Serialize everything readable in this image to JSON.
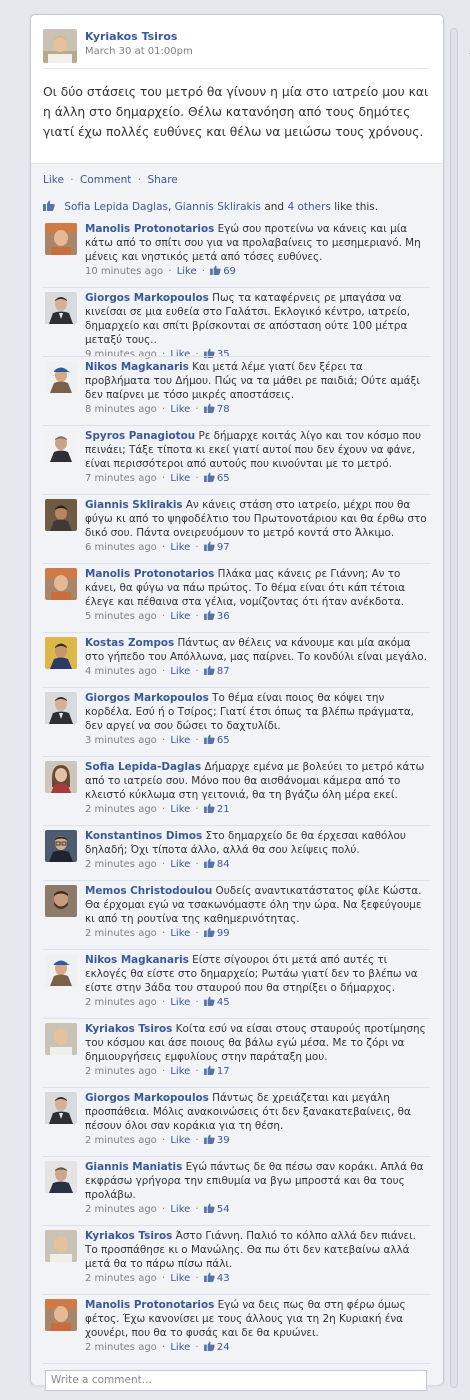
{
  "post": {
    "author": "Kyriakos Tsiros",
    "time": "March 30 at 01:00pm",
    "text": "Οι δύο στάσεις του μετρό θα γίνουν η μία στο ιατρείο μου και η άλλη στο δημαρχείο. Θέλω κατανόηση από τους δημότες γιατί έχω πολλές ευθύνες και θέλω να μειώσω τους χρόνους."
  },
  "actions": {
    "like": "Like",
    "comment": "Comment",
    "share": "Share",
    "sep": "·"
  },
  "likes": {
    "name1": "Sofia Lepida Daglas",
    "comma": ",",
    "name2": "Giannis Sklirakis",
    "and": "and",
    "others": "4 others",
    "suffix": "like this."
  },
  "comments": [
    {
      "name": "Manolis Protonotarios",
      "text": "Εγώ σου προτείνω να κάνεις και μία κάτω από το σπίτι σου για να προλαβαίνεις το μεσημεριανό. Μη μένεις και νηστικός μετά από τόσες ευθύνες.",
      "time": "10 minutes ago",
      "like": "Like",
      "count": "69",
      "avatar": "orange-hat-man"
    },
    {
      "name": "Giorgos Markopoulos",
      "text": "Πως τα καταφέρνεις ρε μπαγάσα να κινείσαι σε μια ευθεία στο Γαλάτσι. Εκλογικό κέντρο, ιατρείο, δημαρχείο και σπίτι βρίσκονται σε απόσταση ούτε 100 μέτρα μεταξύ τους..",
      "time": "9 minutes ago",
      "like": "Like",
      "count": "35",
      "avatar": "man-in-suit"
    },
    {
      "name": "Nikos Magkanaris",
      "text": "Και μετά λέμε γιατί δεν ξέρει τα προβλήματα του Δήμου. Πώς να τα μάθει ρε παιδιά; Ούτε αμάξι δεν παίρνει με τόσο μικρές αποστάσεις.",
      "time": "8 minutes ago",
      "like": "Like",
      "count": "78",
      "avatar": "man-in-cap"
    },
    {
      "name": "Spyros Panagiotou",
      "text": "Ρε δήμαρχε κοιτάς λίγο και τον κόσμο που πεινάει; Τάξε τίποτα κι εκεί γιατί αυτοί που δεν έχουν να φάνε, είναι περισσότεροι από αυτούς που κινούνται με το μετρό.",
      "time": "7 minutes ago",
      "like": "Like",
      "count": "65",
      "avatar": "man-white-bg"
    },
    {
      "name": "Giannis Sklirakis",
      "text": "Αν κάνεις στάση στο ιατρείο, μέχρι που θα φύγω κι από το ψηφοδέλτιο του Πρωτονοτάριου και θα έρθω στο δικό σου. Πάντα ονειρευόμουν το μετρό κοντά στο Άλκιμο.",
      "time": "6 minutes ago",
      "like": "Like",
      "count": "97",
      "avatar": "man-dark"
    },
    {
      "name": "Manolis Protonotarios",
      "text": "Πλάκα μας κάνεις ρε Γιάννη; Αν το κάνει, θα φύγω να πάω πρώτος. Το θέμα είναι ότι κάπ τέτοια έλεγε και πέθαινα στα γέλια, νομίζοντας ότι ήταν ανέκδοτα.",
      "time": "5 minutes ago",
      "like": "Like",
      "count": "36",
      "avatar": "orange-hat-man"
    },
    {
      "name": "Kostas Zompos",
      "text": "Πάντως αν θέλεις να κάνουμε και μία ακόμα στο γήπεδο του Απόλλωνα, μας παίρνει. Το κονδύλι είναι μεγάλο.",
      "time": "4 minutes ago",
      "like": "Like",
      "count": "87",
      "avatar": "man-yellow"
    },
    {
      "name": "Giorgos Markopoulos",
      "text": "Το θέμα είναι ποιος θα κόψει την κορδέλα. Εσύ ή ο Τσίρος; Γιατί έτσι όπως τα βλέπω πράγματα, δεν αργεί να σου δώσει το δαχτυλίδι.",
      "time": "3 minutes ago",
      "like": "Like",
      "count": "65",
      "avatar": "man-in-suit"
    },
    {
      "name": "Sofia Lepida-Daglas",
      "text": "Δήμαρχε εμένα με βολεύει το μετρό κάτω από το ιατρείο σου. Μόνο που θα αισθάνομαι κάμερα από το κλειστό κύκλωμα στη γειτονιά, θα τη βγάζω όλη μέρα εκεί.",
      "time": "2 minutes ago",
      "like": "Like",
      "count": "21",
      "avatar": "woman"
    },
    {
      "name": "Konstantinos Dimos",
      "text": "Στο δημαρχείο δε θα έρχεσαι καθόλου δηλαδή; Όχι τίποτα άλλο, αλλά θα σου λείψεις πολύ.",
      "time": "2 minutes ago",
      "like": "Like",
      "count": "84",
      "avatar": "man-glasses"
    },
    {
      "name": "Memos Christodoulou",
      "text": "Ουδείς αναντικατάστατος φίλε Κώστα. Θα έρχομαι εγώ να τσακωνόμαστε όλη την ώρα. Να ξεφεύγουμε κι από τη ρουτίνα της καθημερινότητας.",
      "time": "2 minutes ago",
      "like": "Like",
      "count": "99",
      "avatar": "man-beard"
    },
    {
      "name": "Nikos Magkanaris",
      "text": "Είστε σίγουροι ότι μετά από αυτές τι εκλογές θα είστε στο δημαρχείο; Ρωτάω γιατί δεν το βλέπω να είστε στην 3άδα του σταυρού που θα στηρίξει ο δήμαρχος.",
      "time": "2 minutes ago",
      "like": "Like",
      "count": "45",
      "avatar": "man-in-cap"
    },
    {
      "name": "Kyriakos Tsiros",
      "text": "Κοίτα εσύ να είσαι στους σταυρούς προτίμησης του κόσμου και άσε ποιους θα βάλω εγώ μέσα. Με το ζόρι να δημιουργήσεις εμφυλίους στην παράταξη μου.",
      "time": "2 minutes ago",
      "like": "Like",
      "count": "17",
      "avatar": "bald-man"
    },
    {
      "name": "Giorgos Markopoulos",
      "text": "Πάντως δε χρειάζεται και μεγάλη προσπάθεια. Μόλις ανακοινώσεις ότι δεν ξανακατεβαίνεις, θα πέσουν όλοι σαν κοράκια για τη θέση.",
      "time": "2 minutes ago",
      "like": "Like",
      "count": "39",
      "avatar": "man-in-suit"
    },
    {
      "name": "Giannis Maniatis",
      "text": "Εγώ πάντως δε θα πέσω σαν κοράκι. Απλά θα εκφράσω γρήγορα την επιθυμία να βγω μπροστά και θα τους προλάβω.",
      "time": "2 minutes ago",
      "like": "Like",
      "count": "54",
      "avatar": "man-grey"
    },
    {
      "name": "Kyriakos Tsiros",
      "text": "Άστο Γιάννη. Παλιό το κόλπο αλλά δεν πιάνει. Το προσπάθησε κι ο Μανώλης. Θα πω ότι δεν κατεβαίνω αλλά μετά θα το πάρω πίσω πάλι.",
      "time": "2 minutes ago",
      "like": "Like",
      "count": "43",
      "avatar": "bald-man"
    },
    {
      "name": "Manolis Protonotarios",
      "text": "Εγώ να δεις πως θα στη φέρω όμως φέτος. Έχω κανονίσει με τους άλλους για τη 2η Κυριακή ένα χουνέρι, που θα το φυσάς και δε θα κρυώνει.",
      "time": "2 minutes ago",
      "like": "Like",
      "count": "24",
      "avatar": "orange-hat-man"
    }
  ],
  "write_comment": {
    "placeholder": "Write a comment..."
  },
  "colors": {
    "link": "#3b5998",
    "meta": "#808080",
    "background": "#e6e8ed",
    "comment_bg": "#f1f3f7"
  }
}
